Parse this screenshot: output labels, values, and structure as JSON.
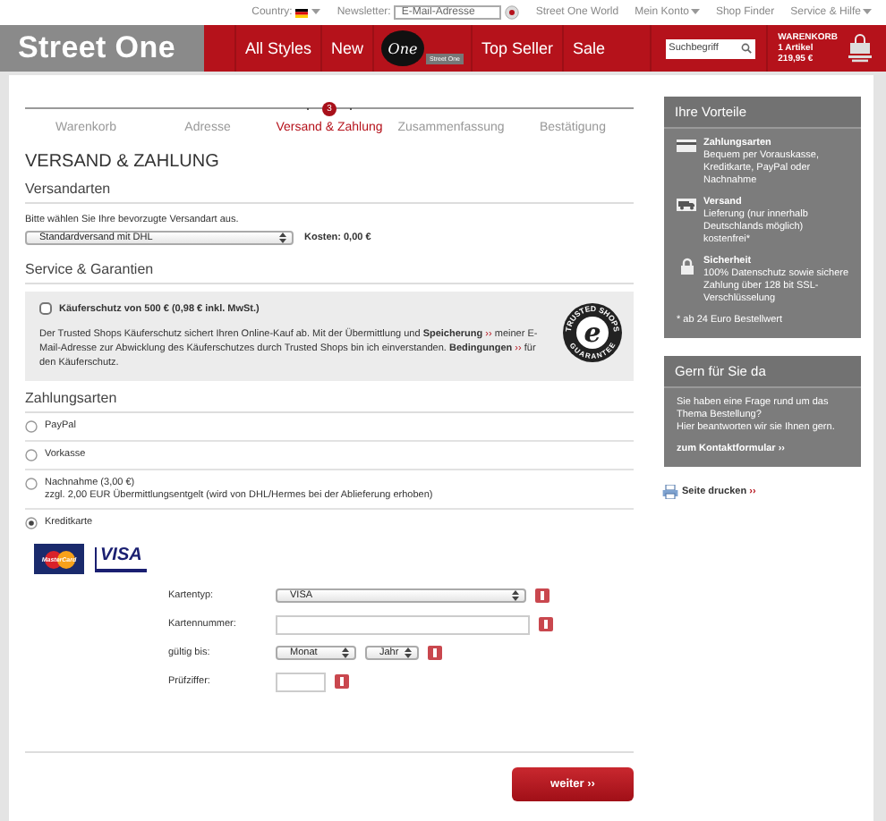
{
  "top_bar": {
    "country_label": "Country:",
    "newsletter_label": "Newsletter:",
    "newsletter_placeholder": "E-Mail-Adresse",
    "links": [
      {
        "label": "Street One World",
        "dropdown": false
      },
      {
        "label": "Mein Konto",
        "dropdown": true
      },
      {
        "label": "Shop Finder",
        "dropdown": false
      },
      {
        "label": "Service & Hilfe",
        "dropdown": true
      }
    ]
  },
  "header": {
    "logo": "Street One",
    "nav": [
      {
        "kind": "text",
        "label": "All Styles"
      },
      {
        "kind": "text",
        "label": "New"
      },
      {
        "kind": "logo",
        "label": "One",
        "badge": "Street One"
      },
      {
        "kind": "text",
        "label": "Top Seller"
      },
      {
        "kind": "text",
        "label": "Sale"
      }
    ],
    "search_placeholder": "Suchbegriff",
    "cart": {
      "title": "WARENKORB",
      "count": "1 Artikel",
      "total": "219,95 €"
    }
  },
  "steps": [
    {
      "label": "Warenkorb",
      "selected": false
    },
    {
      "label": "Adresse",
      "selected": false
    },
    {
      "label": "Versand & Zahlung",
      "number": "3",
      "selected": true
    },
    {
      "label": "Zusammenfassung",
      "selected": false
    },
    {
      "label": "Bestätigung",
      "selected": false
    }
  ],
  "title": "VERSAND & ZAHLUNG",
  "shipping": {
    "heading": "Versandarten",
    "hint": "Bitte wählen Sie Ihre bevorzugte Versandart aus.",
    "method": "Standardversand mit DHL",
    "cost": "Kosten: 0,00 €"
  },
  "service": {
    "heading": "Service & Garantien",
    "label": "Käuferschutz von 500 € (0,98 € inkl. MwSt.)",
    "checked": false,
    "text": [
      {
        "kind": "text",
        "text": "Der Trusted Shops Käuferschutz sichert Ihren Online-Kauf ab. Mit der Übermittlung und "
      },
      {
        "kind": "link",
        "text": "Speicherung",
        "marker": "››"
      },
      {
        "kind": "text",
        "text": " meiner E-Mail-Adresse zur Abwicklung des Käuferschutzes durch Trusted Shops bin ich einverstanden. "
      },
      {
        "kind": "link",
        "text": "Bedingungen",
        "marker": "››"
      },
      {
        "kind": "text",
        "text": " für den Käuferschutz."
      }
    ],
    "seal": {
      "letter": "e",
      "top": "TRUSTED SHOPS",
      "bottom": "GUARANTEE"
    }
  },
  "payment": {
    "heading": "Zahlungsarten",
    "options": [
      {
        "label": "PayPal",
        "selected": false
      },
      {
        "label": "Vorkasse",
        "selected": false
      },
      {
        "label": "Nachnahme (3,00 €)",
        "note": "zzgl. 2,00 EUR Übermittlungsentgelt (wird von DHL/Hermes bei der Ablieferung erhoben)",
        "selected": false
      },
      {
        "label": "Kreditkarte",
        "selected": true
      }
    ],
    "cards": [
      {
        "kind": "mastercard",
        "label": "MasterCard"
      },
      {
        "kind": "visa",
        "label": "VISA"
      }
    ],
    "fields": [
      {
        "kind": "select",
        "label": "Kartentyp:",
        "values": [
          "VISA"
        ]
      },
      {
        "kind": "input",
        "label": "Kartennummer:"
      },
      {
        "kind": "selects",
        "label": "gültig bis:",
        "values": [
          "Monat",
          "Jahr"
        ]
      },
      {
        "kind": "short-input",
        "label": "Prüfziffer:"
      }
    ]
  },
  "next_button": "weiter ››",
  "sidebar": {
    "benefits": {
      "title": "Ihre Vorteile",
      "items": [
        {
          "kind": "card",
          "title": "Zahlungsarten",
          "text": "Bequem per Vorauskasse, Kreditkarte, PayPal oder Nachnahme"
        },
        {
          "kind": "truck",
          "title": "Versand",
          "text": "Lieferung (nur innerhalb Deutschlands möglich) kostenfrei*"
        },
        {
          "kind": "lock",
          "title": "Sicherheit",
          "text": "100% Datenschutz sowie sichere Zahlung über 128 bit SSL-Verschlüsselung"
        }
      ],
      "footnote": "* ab 24 Euro Bestellwert"
    },
    "contact": {
      "title": "Gern für Sie da",
      "lines": [
        "Sie haben eine Frage rund um das Thema Bestellung?",
        "Hier beantworten wir sie Ihnen gern."
      ],
      "link": "zum Kontaktformular",
      "marker": "››"
    },
    "print": {
      "label": "Seite drucken",
      "marker": "››"
    }
  }
}
